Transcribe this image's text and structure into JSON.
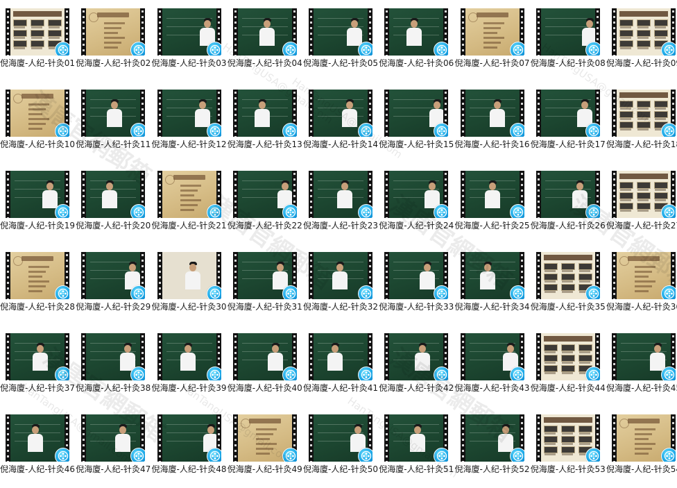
{
  "folder": {
    "view": "large-icons",
    "files": [
      {
        "name": "倪海廈-人纪-针灸01",
        "scene": "menu"
      },
      {
        "name": "倪海廈-人纪-针灸02",
        "scene": "slide"
      },
      {
        "name": "倪海廈-人纪-针灸03",
        "scene": "board"
      },
      {
        "name": "倪海廈-人纪-针灸04",
        "scene": "board"
      },
      {
        "name": "倪海廈-人纪-针灸05",
        "scene": "board"
      },
      {
        "name": "倪海廈-人纪-针灸06",
        "scene": "board"
      },
      {
        "name": "倪海廈-人纪-针灸07",
        "scene": "slide"
      },
      {
        "name": "倪海廈-人纪-针灸08",
        "scene": "board"
      },
      {
        "name": "倪海廈-人纪-针灸09",
        "scene": "menu"
      },
      {
        "name": "倪海廈-人纪-针灸10",
        "scene": "slide"
      },
      {
        "name": "倪海廈-人纪-针灸11",
        "scene": "board"
      },
      {
        "name": "倪海廈-人纪-针灸12",
        "scene": "board"
      },
      {
        "name": "倪海廈-人纪-针灸13",
        "scene": "board"
      },
      {
        "name": "倪海廈-人纪-针灸14",
        "scene": "board"
      },
      {
        "name": "倪海廈-人纪-针灸15",
        "scene": "board"
      },
      {
        "name": "倪海廈-人纪-针灸16",
        "scene": "board"
      },
      {
        "name": "倪海廈-人纪-针灸17",
        "scene": "board"
      },
      {
        "name": "倪海廈-人纪-针灸18",
        "scene": "menu"
      },
      {
        "name": "倪海廈-人纪-针灸19",
        "scene": "board"
      },
      {
        "name": "倪海廈-人纪-针灸20",
        "scene": "board"
      },
      {
        "name": "倪海廈-人纪-针灸21",
        "scene": "slide"
      },
      {
        "name": "倪海廈-人纪-针灸22",
        "scene": "board"
      },
      {
        "name": "倪海廈-人纪-针灸23",
        "scene": "board"
      },
      {
        "name": "倪海廈-人纪-针灸24",
        "scene": "board"
      },
      {
        "name": "倪海廈-人纪-针灸25",
        "scene": "board"
      },
      {
        "name": "倪海廈-人纪-针灸26",
        "scene": "board"
      },
      {
        "name": "倪海廈-人纪-针灸27",
        "scene": "menu"
      },
      {
        "name": "倪海廈-人纪-针灸28",
        "scene": "slide"
      },
      {
        "name": "倪海廈-人纪-针灸29",
        "scene": "board"
      },
      {
        "name": "倪海廈-人纪-针灸30",
        "scene": "room"
      },
      {
        "name": "倪海廈-人纪-针灸31",
        "scene": "board"
      },
      {
        "name": "倪海廈-人纪-针灸32",
        "scene": "board"
      },
      {
        "name": "倪海廈-人纪-针灸33",
        "scene": "board"
      },
      {
        "name": "倪海廈-人纪-针灸34",
        "scene": "board"
      },
      {
        "name": "倪海廈-人纪-针灸35",
        "scene": "menu"
      },
      {
        "name": "倪海廈-人纪-针灸36",
        "scene": "slide"
      },
      {
        "name": "倪海廈-人纪-针灸37",
        "scene": "board"
      },
      {
        "name": "倪海廈-人纪-针灸38",
        "scene": "board"
      },
      {
        "name": "倪海廈-人纪-针灸39",
        "scene": "board"
      },
      {
        "name": "倪海廈-人纪-针灸40",
        "scene": "board"
      },
      {
        "name": "倪海廈-人纪-针灸41",
        "scene": "board"
      },
      {
        "name": "倪海廈-人纪-针灸42",
        "scene": "board"
      },
      {
        "name": "倪海廈-人纪-针灸43",
        "scene": "board"
      },
      {
        "name": "倪海廈-人纪-针灸44",
        "scene": "menu"
      },
      {
        "name": "倪海廈-人纪-针灸45",
        "scene": "board"
      },
      {
        "name": "倪海廈-人纪-针灸46",
        "scene": "board"
      },
      {
        "name": "倪海廈-人纪-针灸47",
        "scene": "board"
      },
      {
        "name": "倪海廈-人纪-针灸48",
        "scene": "board"
      },
      {
        "name": "倪海廈-人纪-针灸49",
        "scene": "slide"
      },
      {
        "name": "倪海廈-人纪-针灸50",
        "scene": "board"
      },
      {
        "name": "倪海廈-人纪-针灸51",
        "scene": "board"
      },
      {
        "name": "倪海廈-人纪-针灸52",
        "scene": "board"
      },
      {
        "name": "倪海廈-人纪-针灸53",
        "scene": "menu"
      },
      {
        "name": "倪海廈-人纪-针灸54",
        "scene": "slide"
      }
    ]
  },
  "watermark": {
    "text_cn": "漢唐官網郵箱",
    "text_en": "HanTangUSA@gmail.com"
  },
  "colors": {
    "badge": "#1aa6e6",
    "chalkboard": "#1c4630",
    "slide": "#d4ba83"
  },
  "icons": {
    "media_badge": "media-player-icon"
  }
}
